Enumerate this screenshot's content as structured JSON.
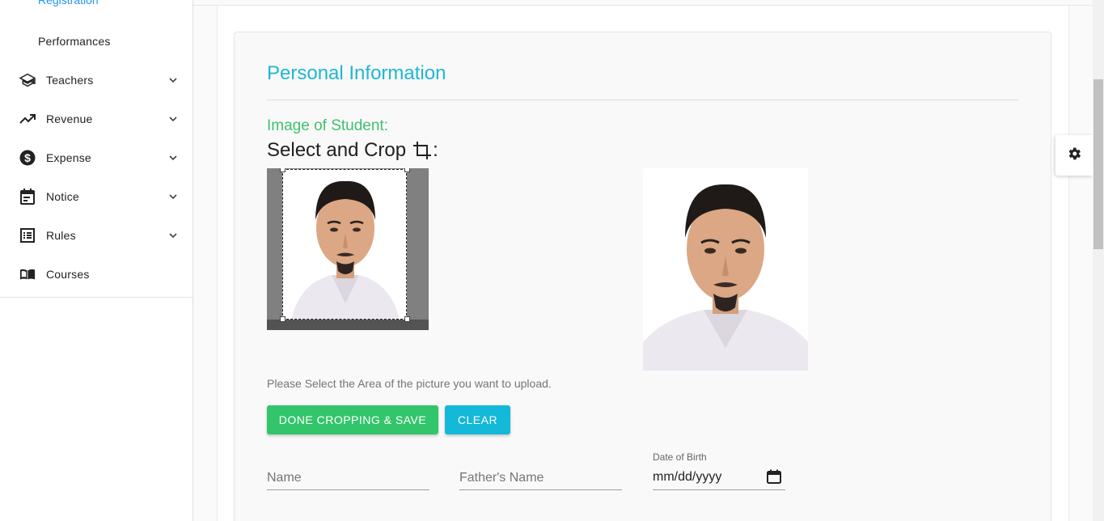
{
  "sidebar": {
    "partial_item": "Registration",
    "sub_item": "Performances",
    "items": [
      {
        "label": "Teachers",
        "icon": "graduation-cap-icon"
      },
      {
        "label": "Revenue",
        "icon": "trending-up-icon"
      },
      {
        "label": "Expense",
        "icon": "dollar-circle-icon"
      },
      {
        "label": "Notice",
        "icon": "calendar-icon"
      },
      {
        "label": "Rules",
        "icon": "list-icon"
      },
      {
        "label": "Courses",
        "icon": "book-icon"
      }
    ]
  },
  "form": {
    "section_title": "Personal Information",
    "image_label": "Image of Student:",
    "crop_title": "Select and Crop",
    "crop_colon": ":",
    "hint": "Please Select the Area of the picture you want to upload.",
    "save_button": "DONE CROPPING & SAVE",
    "clear_button": "CLEAR",
    "name_placeholder": "Name",
    "father_placeholder": "Father's Name",
    "dob_label": "Date of Birth",
    "dob_value": "mm/dd/yyyy"
  },
  "colors": {
    "accent_cyan": "#1fb6d4",
    "accent_green": "#33c56b",
    "link_blue": "#2196f3"
  }
}
